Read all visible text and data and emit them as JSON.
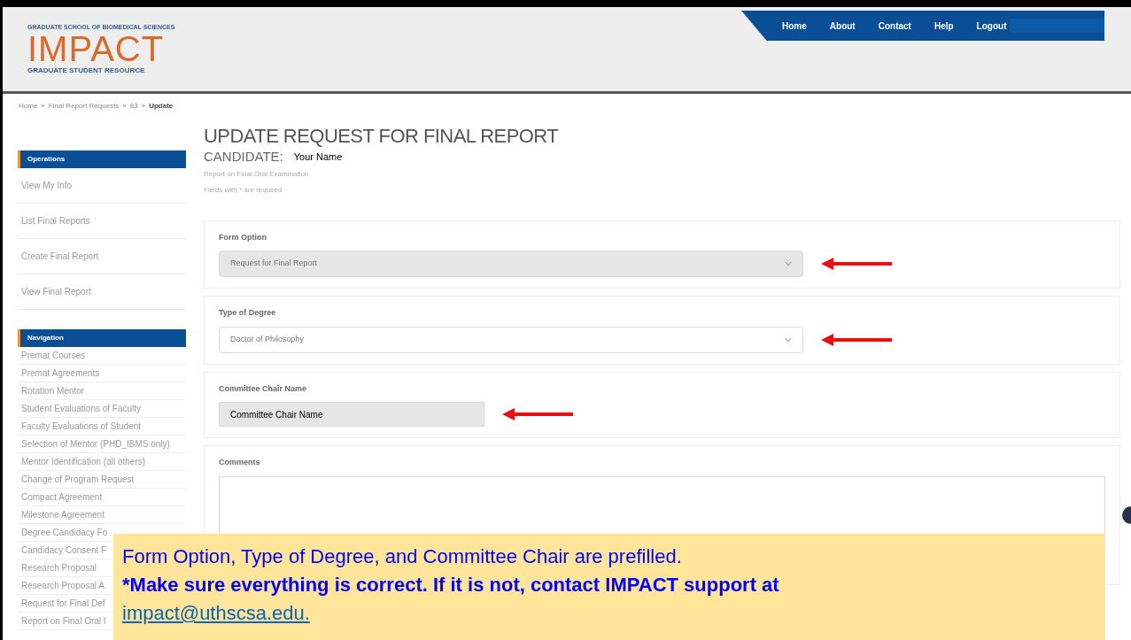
{
  "header": {
    "logo": {
      "top": "GRADUATE SCHOOL OF BIOMEDICAL SCIENCES",
      "name": "IMPACT",
      "bottom": "GRADUATE STUDENT RESOURCE"
    },
    "nav": [
      {
        "label": "Home"
      },
      {
        "label": "About"
      },
      {
        "label": "Contact"
      },
      {
        "label": "Help"
      },
      {
        "label": "Logout"
      }
    ]
  },
  "breadcrumb": {
    "separator": "»",
    "items": [
      {
        "label": "Home",
        "current": false
      },
      {
        "label": "Final Report Requests",
        "current": false
      },
      {
        "label": "83",
        "current": false
      },
      {
        "label": "Update",
        "current": true
      }
    ]
  },
  "sidebar": [
    {
      "title": "Operations",
      "kind": "spaced",
      "items": [
        "View My Info",
        "List Final Reports",
        "Create Final Report",
        "View Final Report"
      ]
    },
    {
      "title": "Navigation",
      "kind": "compact",
      "items": [
        "Premat Courses",
        "Premat Agreements",
        "Rotation Mentor",
        "Student Evaluations of Faculty",
        "Faculty Evaluations of Student",
        "Selection of Mentor (PHD_IBMS only)",
        "Mentor Identification (all others)",
        "Change of Program Request",
        "Compact Agreement",
        "Milestone Agreement",
        "Degree Candidacy Fo",
        "Candidacy Consent F",
        "Research Proposal",
        "Research Proposal A",
        "Request for Final Def",
        "Report on Final Oral I"
      ]
    }
  ],
  "page": {
    "title": "UPDATE REQUEST FOR FINAL REPORT",
    "candidate_label": "CANDIDATE:",
    "candidate_name": "Your Name",
    "subtitle": "Report on Final Oral Examination",
    "required_note": {
      "before": "Fields with",
      "mark": "*",
      "after": "are required"
    }
  },
  "form": [
    {
      "kind": "select",
      "label": "Form Option",
      "value": "Request for Final Report",
      "disabled": true,
      "pointed": true
    },
    {
      "kind": "select",
      "label": "Type of Degree",
      "value": "Doctor of Philosophy",
      "disabled": false,
      "pointed": true
    },
    {
      "kind": "text",
      "label": "Committee Chair Name",
      "value": "Committee Chair  Name",
      "disabled": true,
      "pointed": true
    },
    {
      "kind": "textarea",
      "label": "Comments",
      "disabled": false,
      "pointed": false
    }
  ],
  "note": {
    "line1": "Form Option, Type of Degree, and Committee Chair are prefilled.",
    "line2": "*Make sure everything is correct. If it is not, contact IMPACT support at",
    "email": "impact@uthscsa.edu."
  }
}
